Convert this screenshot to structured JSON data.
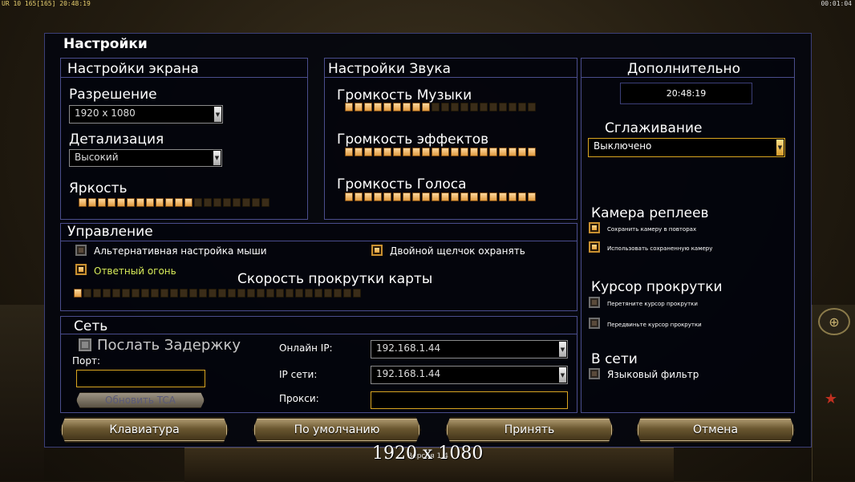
{
  "hud": {
    "left": "UR 10 165[165] 20:48:19",
    "right": "00:01:04"
  },
  "dialog": {
    "title": "Настройки"
  },
  "screen": {
    "title": "Настройки экрана",
    "resolution_label": "Разрешение",
    "resolution_value": "1920 x 1080",
    "detail_label": "Детализация",
    "detail_value": "Высокий",
    "brightness_label": "Яркость",
    "brightness_level": 12,
    "brightness_total": 20
  },
  "sound": {
    "title": "Настройки Звука",
    "music_label": "Громкость Музыки",
    "music_level": 9,
    "effects_label": "Громкость эффектов",
    "effects_level": 20,
    "voice_label": "Громкость Голоса",
    "voice_level": 20,
    "total": 20
  },
  "extra": {
    "title": "Дополнительно",
    "clock": "20:48:19",
    "antialias_label": "Сглаживание",
    "antialias_value": "Выключено",
    "replay_camera_title": "Камера реплеев",
    "replay_save_camera": "Сохранить камеру в повторах",
    "replay_use_saved": "Использовать сохраненную камеру",
    "scroll_cursor_title": "Курсор прокрутки",
    "scroll_drag": "Перетяните курсор прокрутки",
    "scroll_move": "Передвиньте курсор прокрутки",
    "online_title": "В сети",
    "language_filter": "Языковый фильтр"
  },
  "control": {
    "title": "Управление",
    "alt_mouse": "Альтернативная настройка мыши",
    "double_click": "Двойной щелчок охранять",
    "return_fire": "Ответный огонь",
    "scroll_speed_label": "Скорость прокрутки карты",
    "scroll_level": 1,
    "scroll_total": 30
  },
  "network": {
    "title": "Сеть",
    "send_delay": "Послать Задержку",
    "port_label": "Порт:",
    "update_tca": "Обновить TCA",
    "online_ip_label": "Онлайн IP:",
    "online_ip_value": "192.168.1.44",
    "lan_ip_label": "IP сети:",
    "lan_ip_value": "192.168.1.44",
    "proxy_label": "Прокси:"
  },
  "buttons": {
    "keyboard": "Клавиатура",
    "defaults": "По умолчанию",
    "accept": "Принять",
    "cancel": "Отмена"
  },
  "footer": {
    "resolution_overlay": "1920 x 1080",
    "version": "Версия 1.4"
  }
}
